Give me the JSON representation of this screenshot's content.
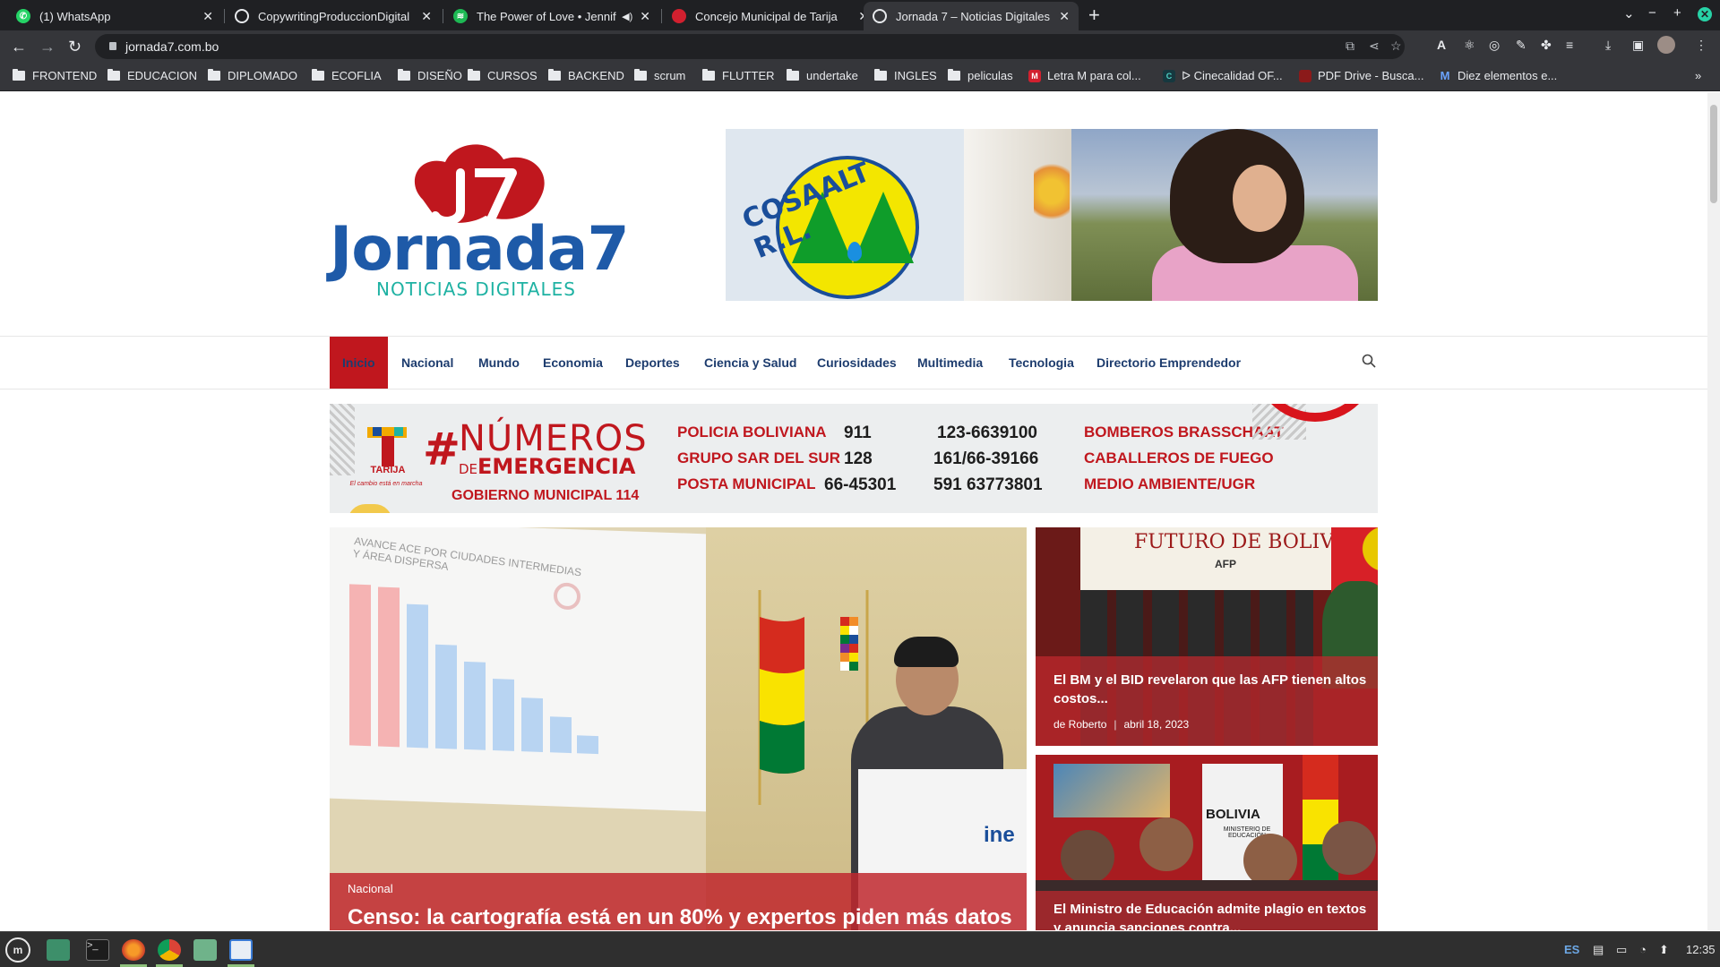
{
  "browser": {
    "tabs": [
      {
        "label": "(1) WhatsApp",
        "icon": "whatsapp-icon",
        "color": "#25d366"
      },
      {
        "label": "CopywritingProduccionDigital",
        "icon": "globe-icon",
        "color": "#e8eaed"
      },
      {
        "label": "The Power of Love • Jennifer",
        "icon": "spotify-icon",
        "color": "#1db954"
      },
      {
        "label": "Concejo Municipal de Tarija",
        "icon": "concejo-icon",
        "color": "#d2202f"
      },
      {
        "label": "Jornada 7 – Noticias Digitales",
        "icon": "globe-icon",
        "color": "#e8eaed"
      }
    ],
    "url": "jornada7.com.bo",
    "bookmarks": [
      {
        "label": "FRONTEND",
        "type": "folder"
      },
      {
        "label": "EDUCACION",
        "type": "folder"
      },
      {
        "label": "DIPLOMADO",
        "type": "folder"
      },
      {
        "label": "ECOFLIA",
        "type": "folder"
      },
      {
        "label": "DISEÑO",
        "type": "folder"
      },
      {
        "label": "CURSOS",
        "type": "folder"
      },
      {
        "label": "BACKEND",
        "type": "folder"
      },
      {
        "label": "scrum",
        "type": "folder"
      },
      {
        "label": "FLUTTER",
        "type": "folder"
      },
      {
        "label": "undertake",
        "type": "folder"
      },
      {
        "label": "INGLES",
        "type": "folder"
      },
      {
        "label": "peliculas",
        "type": "folder"
      },
      {
        "label": "Letra M para col...",
        "type": "link"
      },
      {
        "label": "ᐅ Cinecalidad OF...",
        "type": "link"
      },
      {
        "label": "PDF Drive - Busca...",
        "type": "link"
      },
      {
        "label": "Diez elementos e...",
        "type": "link"
      }
    ]
  },
  "site": {
    "logo_main": "Jornada",
    "logo_seven": "7",
    "logo_sub": "NOTICIAS DIGITALES",
    "banner_brand": "COSAALT R.L.",
    "nav": [
      "Inicio",
      "Nacional",
      "Mundo",
      "Economia",
      "Deportes",
      "Ciencia y Salud",
      "Curiosidades",
      "Multimedia",
      "Tecnologia",
      "Directorio Emprendedor"
    ],
    "accent": "#c0171e"
  },
  "emergency_ad": {
    "hash": "#",
    "title1": "NÚMEROS",
    "title2_prefix": "DE",
    "title2": "EMERGENCIA",
    "gob": "GOBIERNO MUNICIPAL",
    "gob_number": "114",
    "tarija": "TARIJA",
    "tarija_tagline": "El cambio está en marcha",
    "rows": [
      {
        "name": "POLICIA BOLIVIANA",
        "short": "911",
        "long": "123-6639100",
        "right": "BOMBEROS BRASSCHAAT"
      },
      {
        "name": "GRUPO SAR DEL SUR",
        "short": "128",
        "long": "161/66-39166",
        "right": "CABALLEROS DE  FUEGO"
      },
      {
        "name": "POSTA MUNICIPAL",
        "short": "66-45301",
        "long": "591 63773801",
        "right": "MEDIO AMBIENTE/UGR"
      }
    ]
  },
  "featured": {
    "category": "Nacional",
    "title": "Censo: la cartografía está en un 80% y expertos piden más datos",
    "screen_title": "AVANCE ACE POR CIUDADES INTERMEDIAS Y ÁREA DISPERSA",
    "ine_label": "ine"
  },
  "side_news": [
    {
      "title": "El BM y el BID revelaron que las AFP tienen altos costos...",
      "author": "de Roberto",
      "date": "abril 18, 2023",
      "sign": "FUTURO DE BOLIVIA",
      "sign_sub": "AFP"
    },
    {
      "title": "El Ministro de Educación admite plagio en textos y anuncia sanciones contra...",
      "sign": "BOLIVIA",
      "sign_sub": "MINISTERIO DE EDUCACIÓN"
    }
  ],
  "taskbar": {
    "lang": "ES",
    "time": "12:35"
  }
}
